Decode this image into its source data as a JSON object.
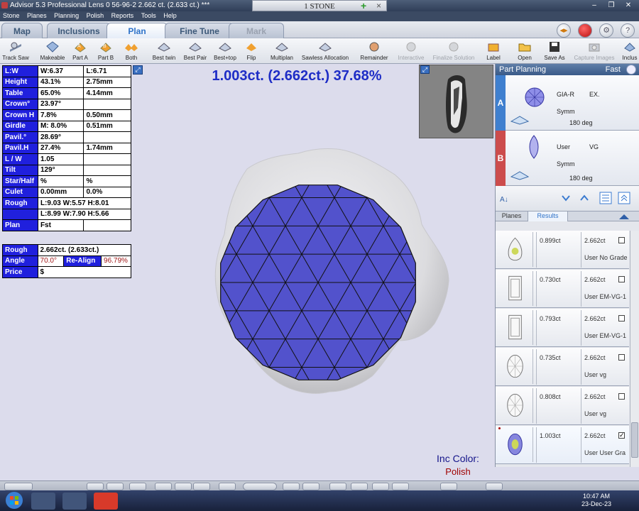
{
  "window": {
    "title": "Advisor 5.3 Professional    Lens 0    56-96-2    2.662 ct. (2.633 ct.) ***",
    "center_tab": "1 STONE",
    "plus": "+",
    "close_x": "×",
    "controls": [
      "–",
      "❐",
      "✕"
    ]
  },
  "menu": [
    "Stone",
    "Planes",
    "Planning",
    "Polish",
    "Reports",
    "Tools",
    "Help"
  ],
  "tabs": [
    {
      "label": "Map"
    },
    {
      "label": "Inclusions"
    },
    {
      "label": "Plan"
    },
    {
      "label": "Fine Tune"
    },
    {
      "label": "Mark"
    }
  ],
  "active_tab": "Plan",
  "tab_buttons": {
    "b1": "◂▸",
    "b2": "",
    "b3": "⚙",
    "b4": "?"
  },
  "toolbar": [
    {
      "label": "Track Saw"
    },
    {
      "label": "Makeable"
    },
    {
      "label": "Part A"
    },
    {
      "label": "Part B"
    },
    {
      "label": "Both"
    },
    {
      "label": "Best twin"
    },
    {
      "label": "Best Pair"
    },
    {
      "label": "Best+top"
    },
    {
      "label": "Flip"
    },
    {
      "label": "Multiplan"
    },
    {
      "label": "Sawless Allocation"
    },
    {
      "label": "Remainder"
    },
    {
      "label": "Interactive"
    },
    {
      "label": "Finalize Solution"
    },
    {
      "label": "Label"
    },
    {
      "label": "Open"
    },
    {
      "label": "Save As"
    },
    {
      "label": "Capture Images"
    },
    {
      "label": "Inclus"
    }
  ],
  "params": [
    [
      "L:W",
      "W:6.37",
      "L:6.71"
    ],
    [
      "Height",
      "43.1%",
      "2.75mm"
    ],
    [
      "Table",
      "65.0%",
      "4.14mm"
    ],
    [
      "Crown°",
      "23.97°",
      ""
    ],
    [
      "Crown H",
      "7.8%",
      "0.50mm"
    ],
    [
      "Girdle",
      "M: 8.0%",
      "0.51mm"
    ],
    [
      "Pavil.°",
      "28.69°",
      ""
    ],
    [
      "Pavil.H",
      "27.4%",
      "1.74mm"
    ],
    [
      "L / W",
      "1.05",
      ""
    ],
    [
      "Tilt",
      "129°",
      ""
    ],
    [
      "Star/Half",
      "%",
      "%"
    ],
    [
      "Culet",
      "0.00mm",
      "0.0%"
    ],
    [
      "Rough",
      "L:9.03 W:5.57 H:8.01",
      ""
    ],
    [
      "",
      "L:8.99 W:7.90 H:5.66",
      ""
    ],
    [
      "Plan",
      "Fst",
      ""
    ]
  ],
  "summary": {
    "rough_label": "Rough",
    "rough_value": "2.662ct. (2.633ct.)",
    "angle_label": "Angle",
    "angle_value": "70.0°",
    "realign_label": "Re-Align",
    "realign_value": "96.79%",
    "price_label": "Price",
    "price_value": "$"
  },
  "headline": "1.003ct. (2.662ct.) 37.68%",
  "inc_color": {
    "label": "Inc Color:",
    "value": "Polish"
  },
  "part_planning": {
    "title": "Part Planning",
    "mode": "Fast",
    "parts": [
      {
        "letter": "A",
        "grade_system": "GIA-R",
        "grade": "EX.",
        "symm": "Symm",
        "rotation": "180 deg",
        "color": "#3f7fcf"
      },
      {
        "letter": "B",
        "grade_system": "User",
        "grade": "VG",
        "symm": "Symm",
        "rotation": "180 deg",
        "color": "#cc4c4c"
      }
    ],
    "subtabs": [
      "Planes",
      "Results"
    ],
    "active_subtab": "Results"
  },
  "results": [
    {
      "weight": "0.899ct",
      "rough": "2.662ct",
      "name": "User No Grade",
      "shape": "pear-icon",
      "checked": false
    },
    {
      "weight": "0.730ct",
      "rough": "2.662ct",
      "name": "User EM-VG-1",
      "shape": "emerald-icon",
      "checked": false
    },
    {
      "weight": "0.793ct",
      "rough": "2.662ct",
      "name": "User EM-VG-1",
      "shape": "emerald-icon",
      "checked": false
    },
    {
      "weight": "0.735ct",
      "rough": "2.662ct",
      "name": "User vg",
      "shape": "oval-icon",
      "checked": false
    },
    {
      "weight": "0.808ct",
      "rough": "2.662ct",
      "name": "User vg",
      "shape": "oval-icon",
      "checked": false
    },
    {
      "weight": "1.003ct",
      "rough": "2.662ct",
      "name": "User User Gra",
      "shape": "oval-blue-icon",
      "checked": true
    }
  ],
  "clock": {
    "time": "10:47 AM",
    "date": "23-Dec-23"
  },
  "colors": {
    "stone_fill": "#5252cc",
    "label_blue": "#2020dd",
    "headline": "#1e2dc6",
    "rough_gray": "#e2e2e4"
  }
}
